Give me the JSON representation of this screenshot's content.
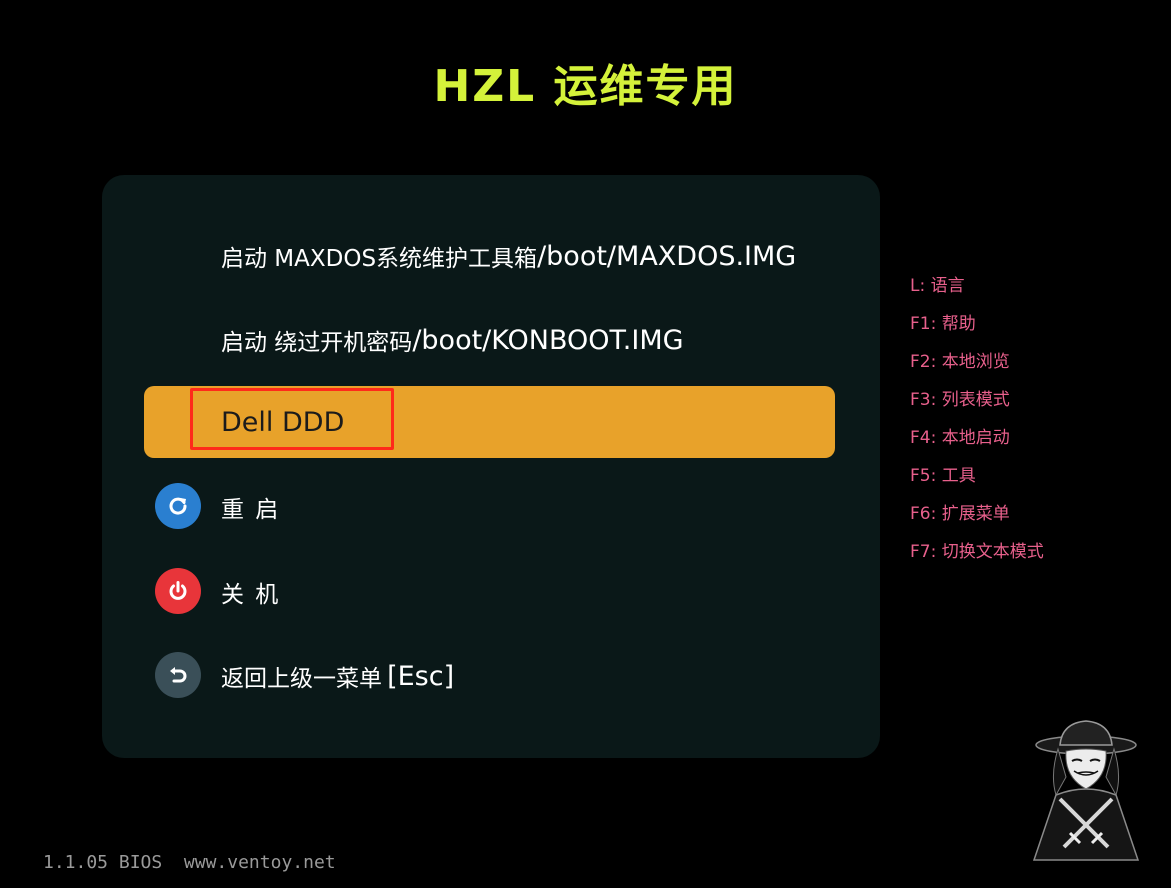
{
  "header": {
    "title": "HZL 运维专用"
  },
  "menu": {
    "items": [
      {
        "prefix": "启动 MAXDOS系统维护工具箱",
        "path": "/boot/MAXDOS.IMG"
      },
      {
        "prefix": "启动 绕过开机密码",
        "path": "/boot/KONBOOT.IMG"
      },
      {
        "label": "Dell DDD",
        "selected": true
      }
    ],
    "system": [
      {
        "label": "重 启",
        "icon": "restart-icon",
        "color": "#2a7fd0"
      },
      {
        "label": "关 机",
        "icon": "power-icon",
        "color": "#e8353a"
      },
      {
        "label": "返回上级一菜单",
        "suffix": "[Esc]",
        "icon": "back-icon",
        "color": "#3a4f58"
      }
    ]
  },
  "hotkeys": [
    "L:  语言",
    "F1: 帮助",
    "F2: 本地浏览",
    "F3: 列表模式",
    "F4: 本地启动",
    "F5: 工具",
    "F6: 扩展菜单",
    "F7: 切换文本模式"
  ],
  "footer": {
    "version": "1.1.05 BIOS",
    "url": "www.ventoy.net"
  },
  "colors": {
    "background": "#000000",
    "panel": "#0a1818",
    "title": "#d4f23a",
    "selected": "#e8a22a",
    "selection_outline": "#ff2a1a",
    "hotkey_text": "#e8608c"
  }
}
